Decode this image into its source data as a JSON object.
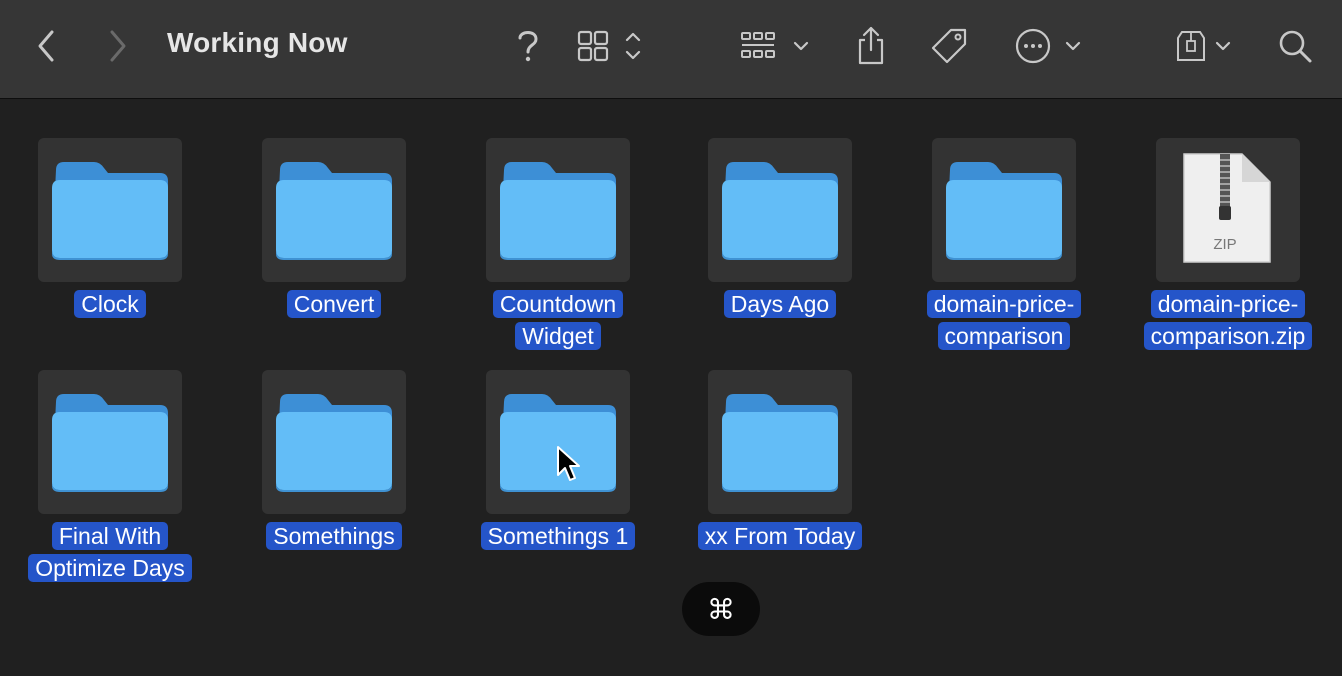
{
  "window": {
    "title": "Working Now"
  },
  "toolbar": {
    "icons": [
      "back-icon",
      "forward-icon",
      "help-icon",
      "grid-view-icon",
      "group-by-icon",
      "share-icon",
      "tag-icon",
      "more-icon",
      "storage-icon",
      "search-icon"
    ]
  },
  "items": [
    {
      "name": "Clock",
      "lines": [
        "Clock"
      ],
      "kind": "folder"
    },
    {
      "name": "Convert",
      "lines": [
        "Convert"
      ],
      "kind": "folder"
    },
    {
      "name": "Countdown Widget",
      "lines": [
        "Countdown",
        "Widget"
      ],
      "kind": "folder"
    },
    {
      "name": "Days Ago",
      "lines": [
        "Days Ago"
      ],
      "kind": "folder"
    },
    {
      "name": "domain-price-comparison",
      "lines": [
        "domain-price-",
        "comparison"
      ],
      "kind": "folder"
    },
    {
      "name": "domain-price-comparison.zip",
      "lines": [
        "domain-price-",
        "comparison.zip"
      ],
      "kind": "zip",
      "badge": "ZIP"
    },
    {
      "name": "Final With Optimize Days",
      "lines": [
        "Final With",
        "Optimize Days"
      ],
      "kind": "folder"
    },
    {
      "name": "Somethings",
      "lines": [
        "Somethings"
      ],
      "kind": "folder"
    },
    {
      "name": "Somethings 1",
      "lines": [
        "Somethings 1"
      ],
      "kind": "folder"
    },
    {
      "name": "xx From Today",
      "lines": [
        "xx From Today"
      ],
      "kind": "folder"
    }
  ],
  "keyboard_hint": {
    "symbol": "⌘"
  },
  "colors": {
    "selection": "#2555c9",
    "folder": "#5fb4f0",
    "toolbar": "#363636",
    "background": "#202020"
  }
}
